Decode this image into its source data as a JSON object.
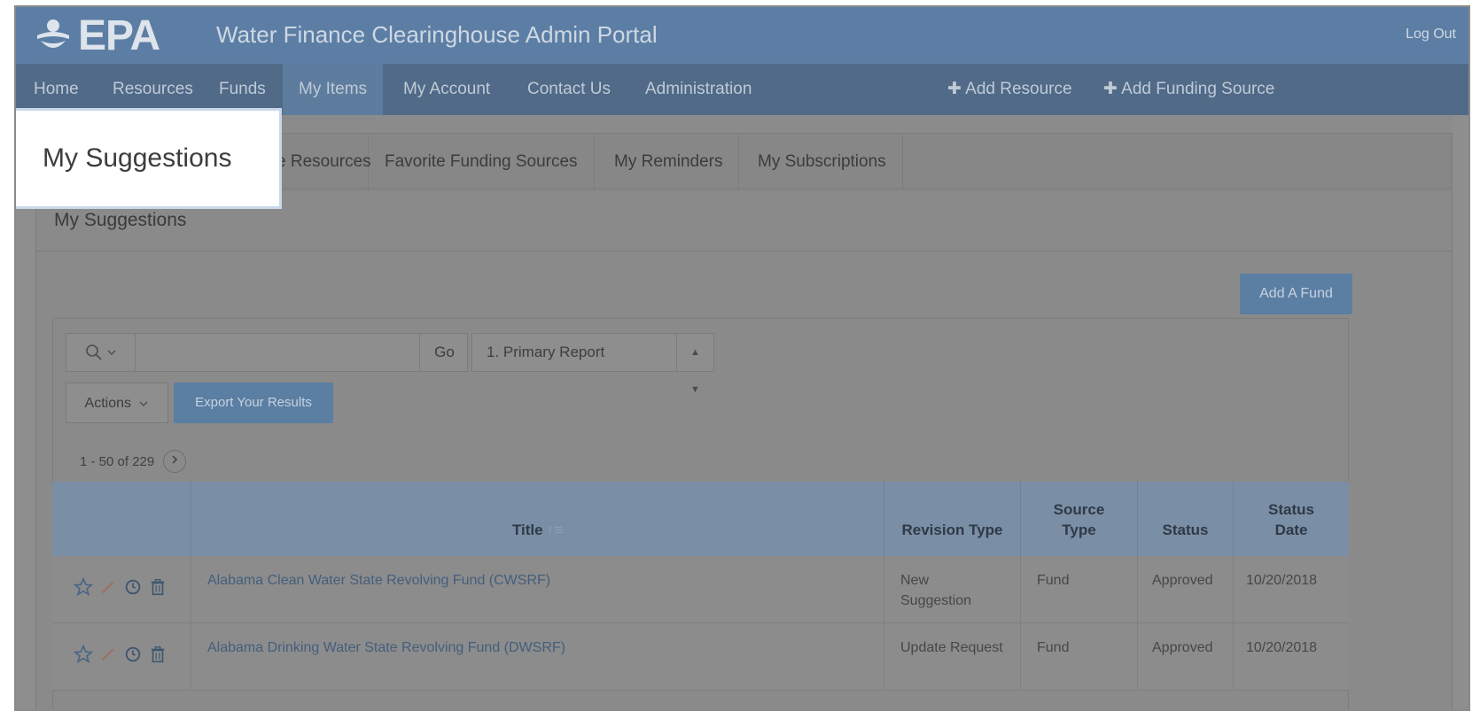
{
  "header": {
    "logo_text": "EPA",
    "app_title": "Water Finance Clearinghouse Admin Portal",
    "logout_label": "Log Out"
  },
  "nav": {
    "items": [
      "Home",
      "Resources",
      "Funds",
      "My Items",
      "My Account",
      "Contact Us",
      "Administration"
    ],
    "active": "My Items",
    "add_resource": "✚ Add Resource",
    "add_funding_source": "✚ Add Funding Source"
  },
  "tabs": {
    "items": [
      "My Suggestions",
      "Favorite Resources",
      "Favorite Funding Sources",
      "My Reminders",
      "My Subscriptions"
    ],
    "partial_favorite_resources": "e Resources"
  },
  "callout_label": "My Suggestions",
  "region": {
    "title": "My Suggestions",
    "add_fund_label": "Add A Fund"
  },
  "toolbar": {
    "go_label": "Go",
    "report_select_value": "1. Primary Report",
    "actions_label": "Actions",
    "export_label": "Export Your Results",
    "pagination_text": "1 - 50 of 229"
  },
  "table": {
    "columns": {
      "title": "Title",
      "revision_type": "Revision Type",
      "source_type_line1": "Source",
      "source_type_line2": "Type",
      "status": "Status",
      "status_date_line1": "Status",
      "status_date_line2": "Date"
    },
    "rows": [
      {
        "title": "Alabama Clean Water State Revolving Fund (CWSRF)",
        "revision_type_line1": "New",
        "revision_type_line2": "Suggestion",
        "source_type": "Fund",
        "status": "Approved",
        "status_date": "10/20/2018"
      },
      {
        "title": "Alabama Drinking Water State Revolving Fund (DWSRF)",
        "revision_type_line1": "Update Request",
        "revision_type_line2": "",
        "source_type": "Fund",
        "status": "Approved",
        "status_date": "10/20/2018"
      }
    ]
  },
  "colors": {
    "header_blue": "#5d7ea4",
    "nav_blue": "#506a88",
    "button_blue": "#5b7ea3",
    "table_header": "#7a8ea6",
    "overlay_gray": "#8b8b8b",
    "callout_border": "#c9d7ea"
  },
  "icons": [
    "search-icon",
    "chevron-down-icon",
    "star-icon",
    "pencil-icon",
    "clock-icon",
    "trash-icon",
    "chevron-right-icon",
    "sort-icon",
    "select-arrows-icon"
  ]
}
